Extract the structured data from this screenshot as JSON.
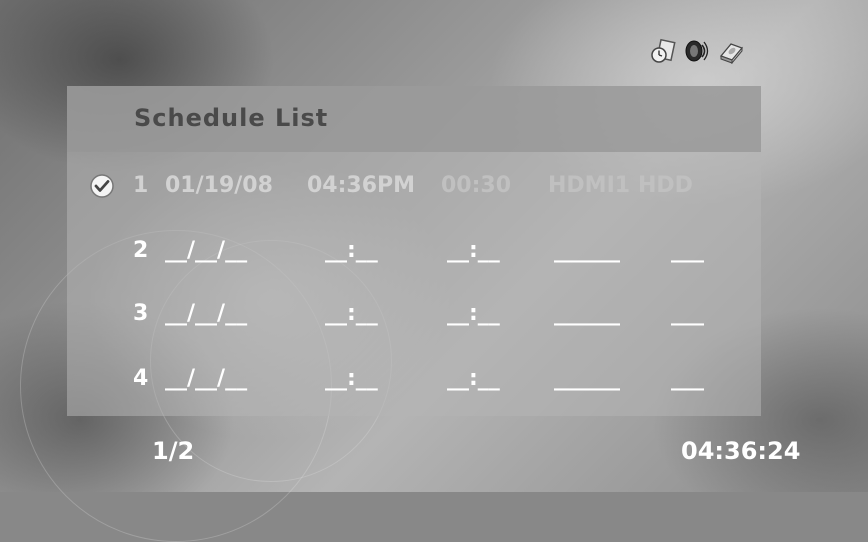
{
  "status_icons": [
    "timer-icon",
    "speaker-icon",
    "disk-icon"
  ],
  "schedule": {
    "title": "Schedule List",
    "rows": [
      {
        "num": "1",
        "date": "01/19/08",
        "time": "04:36PM",
        "duration": "00:30",
        "source": "HDMI1",
        "target": "HDD",
        "checked": true
      },
      {
        "num": "2",
        "date": "__/__/__",
        "time": "__:__",
        "duration": "__:__",
        "source": "______",
        "target": "___"
      },
      {
        "num": "3",
        "date": "__/__/__",
        "time": "__:__",
        "duration": "__:__",
        "source": "______",
        "target": "___"
      },
      {
        "num": "4",
        "date": "__/__/__",
        "time": "__:__",
        "duration": "__:__",
        "source": "______",
        "target": "___"
      }
    ]
  },
  "footer": {
    "page": "1/2",
    "clock": "04:36:24"
  },
  "colors": {
    "panel": "#b4b4b4",
    "title_text": "#4a4a4a",
    "row_text": "#ffffff"
  }
}
